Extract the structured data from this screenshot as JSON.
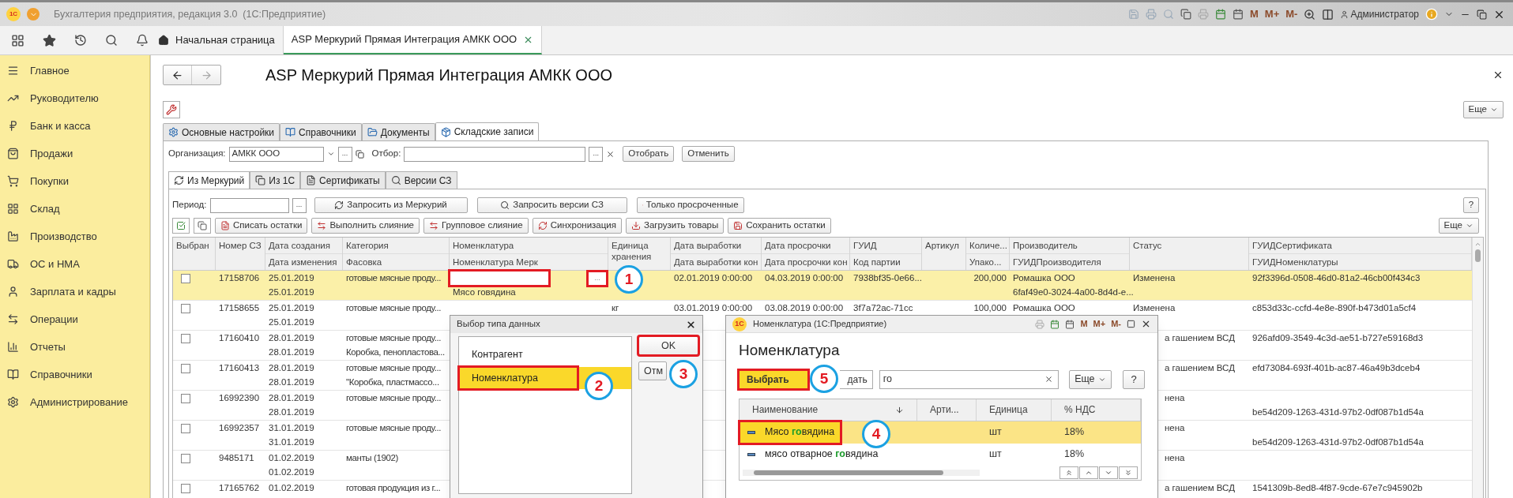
{
  "title_bar": {
    "logo": "1С",
    "title": "Бухгалтерия предприятия, редакция 3.0  (1С:Предприятие)",
    "memory": [
      "M",
      "M+",
      "M-"
    ],
    "user": "Администратор"
  },
  "window_tabs": [
    {
      "label": "Начальная страница",
      "selected": false
    },
    {
      "label": "ASP Меркурий Прямая Интеграция АМКК ООО",
      "selected": true
    }
  ],
  "sidebar": {
    "items": [
      {
        "label": "Главное"
      },
      {
        "label": "Руководителю"
      },
      {
        "label": "Банк и касса"
      },
      {
        "label": "Продажи"
      },
      {
        "label": "Покупки"
      },
      {
        "label": "Склад"
      },
      {
        "label": "Производство"
      },
      {
        "label": "ОС и НМА"
      },
      {
        "label": "Зарплата и кадры"
      },
      {
        "label": "Операции"
      },
      {
        "label": "Отчеты"
      },
      {
        "label": "Справочники"
      },
      {
        "label": "Администрирование"
      }
    ]
  },
  "form": {
    "title": "ASP Меркурий Прямая Интеграция АМКК ООО",
    "more": "Еще",
    "tabs": [
      {
        "label": "Основные настройки",
        "selected": false
      },
      {
        "label": "Справочники",
        "selected": false
      },
      {
        "label": "Документы",
        "selected": false
      },
      {
        "label": "Складские записи",
        "selected": true
      }
    ],
    "org_label": "Организация:",
    "org_value": "АМКК ООО",
    "picker": "...",
    "filter_label": "Отбор:",
    "filter_buttons": [
      "Отобрать",
      "Отменить"
    ],
    "subtabs": [
      {
        "label": "Из Меркурий",
        "selected": true
      },
      {
        "label": "Из 1С",
        "selected": false
      },
      {
        "label": "Сертификаты",
        "selected": false
      },
      {
        "label": "Версии СЗ",
        "selected": false
      }
    ],
    "period_label": "Период:",
    "period_buttons": [
      "Запросить из Меркурий",
      "Запросить версии СЗ",
      "Только просроченные"
    ],
    "help": "?",
    "toolbar": [
      "Списать остатки",
      "Выполнить слияние",
      "Групповое слияние",
      "Синхронизация",
      "Загрузить товары",
      "Сохранить остатки"
    ],
    "toolbar_more": "Еще"
  },
  "table": {
    "columns": [
      {
        "top": "Выбран"
      },
      {
        "top": "Номер СЗ"
      },
      {
        "top": "Дата создания",
        "bottom": "Дата изменения"
      },
      {
        "top": "Категория",
        "bottom": "Фасовка"
      },
      {
        "top": "Номенклатура",
        "bottom": "Номенклатура Мерк"
      },
      {
        "top": "Единица хранения"
      },
      {
        "top": "Дата выработки",
        "bottom": "Дата выработки кон"
      },
      {
        "top": "Дата просрочки",
        "bottom": "Дата просрочки кон"
      },
      {
        "top": "ГУИД",
        "bottom": "Код партии"
      },
      {
        "top": "Артикул"
      },
      {
        "top": "Количе...",
        "bottom": "Упако..."
      },
      {
        "top": "Производитель",
        "bottom": "ГУИДПроизводителя"
      },
      {
        "top": "Статус"
      },
      {
        "top": "ГУИДСертификата",
        "bottom": "ГУИДНоменклатуры"
      }
    ],
    "rows": [
      {
        "selected": true,
        "checked": false,
        "editing": true,
        "marked": true,
        "picker": "...",
        "number": "17158706",
        "created": "25.01.2019",
        "changed": "25.01.2019",
        "category": "готовые мясные проду...",
        "nomenclature_merc": "Мясо говядина",
        "produced": "02.01.2019 0:00:00",
        "expires": "04.03.2019 0:00:00",
        "guid": "7938bf35-0e66...",
        "quantity": "200,000",
        "producer": "Ромашка ООО",
        "producer_guid": "6faf49e0-3024-4a00-8d4d-e...",
        "status": "Изменена",
        "cert_guid": "92f3396d-0508-46d0-81a2-46cb00f434c3"
      },
      {
        "selected": false,
        "checked": false,
        "number": "17158655",
        "created": "25.01.2019",
        "changed": "25.01.2019",
        "category": "готовые мясные проду...",
        "unit": "кг",
        "produced": "03.01.2019 0:00:00",
        "expires": "03.08.2019 0:00:00",
        "guid": "3f7a72ac-71cc",
        "quantity": "100,000",
        "producer": "Ромашка ООО",
        "status": "Изменена",
        "cert_guid": "c853d33c-ccfd-4e8e-890f-b473d01a5cf4"
      },
      {
        "selected": false,
        "checked": false,
        "number": "17160410",
        "created": "28.01.2019",
        "changed": "28.01.2019",
        "category": "готовые мясные проду...",
        "packing": "Коробка, пенопластова...",
        "status": "а гашением ВСД",
        "cert_guid": "926afd09-3549-4c3d-ae51-b727e59168d3"
      },
      {
        "selected": false,
        "checked": false,
        "number": "17160413",
        "created": "28.01.2019",
        "changed": "28.01.2019",
        "category": "готовые мясные проду...",
        "packing": "\"Коробка, пластмассо...",
        "status": "а гашением ВСД",
        "cert_guid": "efd73084-693f-401b-ac87-46a49b3dceb4"
      },
      {
        "selected": false,
        "checked": false,
        "number": "16992390",
        "created": "28.01.2019",
        "changed": "28.01.2019",
        "category": "готовые мясные проду...",
        "status": "нена",
        "nom_guid": "be54d209-1263-431d-97b2-0df087b1d54a"
      },
      {
        "selected": false,
        "checked": false,
        "number": "16992357",
        "created": "31.01.2019",
        "changed": "31.01.2019",
        "category": "готовые мясные проду...",
        "status": "нена",
        "nom_guid": "be54d209-1263-431d-97b2-0df087b1d54a"
      },
      {
        "selected": false,
        "checked": false,
        "number": "9485171",
        "created": "01.02.2019",
        "changed": "01.02.2019",
        "category": "манты (1902)",
        "status": "нена"
      },
      {
        "selected": false,
        "checked": false,
        "number": "17165762",
        "created": "01.02.2019",
        "category": "готовая продукция из г...",
        "status": "а гашением ВСД",
        "cert_guid": "1541309b-8ed8-4f87-9cde-67e7c945902b"
      }
    ]
  },
  "type_dialog": {
    "title": "Выбор типа данных",
    "items": [
      {
        "label": "Контрагент",
        "selected": false,
        "marked": false
      },
      {
        "label": "Номенклатура",
        "selected": true,
        "marked": true
      }
    ],
    "buttons": [
      {
        "label": "OK",
        "marked": true
      },
      {
        "label": "Отм",
        "marked": false
      }
    ]
  },
  "nom_dialog": {
    "logo": "1С",
    "title": "Номенклатура (1С:Предприятие)",
    "memory": [
      "M",
      "M+",
      "M-"
    ],
    "heading": "Номенклатура",
    "buttons": [
      {
        "label": "Выбрать",
        "marked": true
      },
      {
        "label": "дать",
        "marked": false
      }
    ],
    "search_value": "го",
    "more": "Еще",
    "help": "?",
    "columns": [
      "Наименование",
      "Арти...",
      "Единица",
      "% НДС"
    ],
    "rows": [
      {
        "name_parts": [
          "Мясо ",
          "го",
          "вядина"
        ],
        "unit": "шт",
        "vat": "18%",
        "selected": true,
        "marked": true
      },
      {
        "name_parts": [
          "мясо отварное ",
          "го",
          "вядина"
        ],
        "unit": "шт",
        "vat": "18%",
        "selected": false,
        "marked": false
      }
    ]
  },
  "annotations": [
    {
      "number": "1"
    },
    {
      "number": "2"
    },
    {
      "number": "3"
    },
    {
      "number": "4"
    },
    {
      "number": "5"
    }
  ]
}
